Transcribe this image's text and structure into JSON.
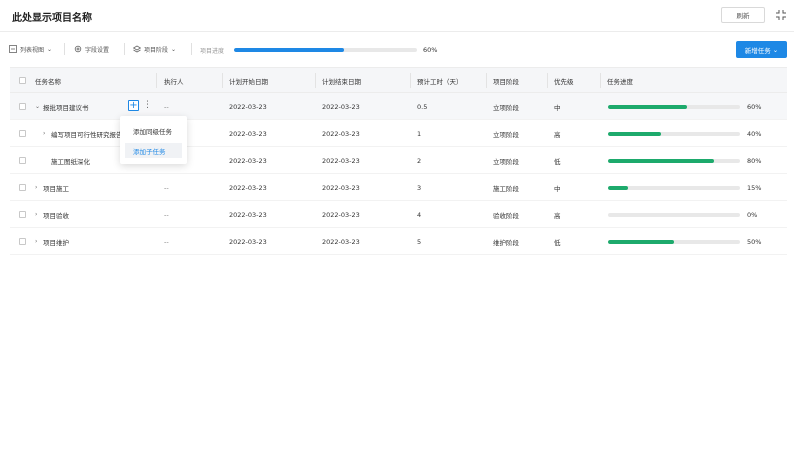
{
  "header": {
    "title": "此处显示项目名称",
    "refresh_label": "刷新",
    "fullscreen_icon": "fullscreen-exit-icon"
  },
  "toolbar": {
    "view_label": "列表视图",
    "field_settings_label": "字段设置",
    "stage_label": "项目阶段",
    "progress_label": "项目进度",
    "progress_value": 60,
    "progress_text": "60%",
    "new_task_label": "新增任务",
    "accent_color": "#1e88e5"
  },
  "table": {
    "columns": [
      "任务名称",
      "执行人",
      "计划开始日期",
      "计划结束日期",
      "预计工时（天）",
      "项目阶段",
      "优先级",
      "任务进度"
    ],
    "rows": [
      {
        "name": "报批项目建议书",
        "chevron": "⌄",
        "assignee": "--",
        "start": "2022-03-23",
        "end": "2022-03-23",
        "hours": "0.5",
        "stage": "立项阶段",
        "priority": "中",
        "progress": 60,
        "progress_text": "60%"
      },
      {
        "name": "编写项目可行性研究报告",
        "chevron": "›",
        "assignee": "",
        "start": "2022-03-23",
        "end": "2022-03-23",
        "hours": "1",
        "stage": "立项阶段",
        "priority": "高",
        "progress": 40,
        "progress_text": "40%"
      },
      {
        "name": "施工图纸深化",
        "chevron": "",
        "assignee": "",
        "start": "2022-03-23",
        "end": "2022-03-23",
        "hours": "2",
        "stage": "立项阶段",
        "priority": "低",
        "progress": 80,
        "progress_text": "80%"
      },
      {
        "name": "项目施工",
        "chevron": "›",
        "assignee": "--",
        "start": "2022-03-23",
        "end": "2022-03-23",
        "hours": "3",
        "stage": "施工阶段",
        "priority": "中",
        "progress": 15,
        "progress_text": "15%"
      },
      {
        "name": "项目验收",
        "chevron": "›",
        "assignee": "--",
        "start": "2022-03-23",
        "end": "2022-03-23",
        "hours": "4",
        "stage": "验收阶段",
        "priority": "高",
        "progress": 0,
        "progress_text": "0%"
      },
      {
        "name": "项目维护",
        "chevron": "›",
        "assignee": "--",
        "start": "2022-03-23",
        "end": "2022-03-23",
        "hours": "5",
        "stage": "维护阶段",
        "priority": "低",
        "progress": 50,
        "progress_text": "50%"
      }
    ],
    "progress_color": "#1daa6c"
  },
  "popup": {
    "items": [
      "添加同级任务",
      "添加子任务"
    ]
  }
}
